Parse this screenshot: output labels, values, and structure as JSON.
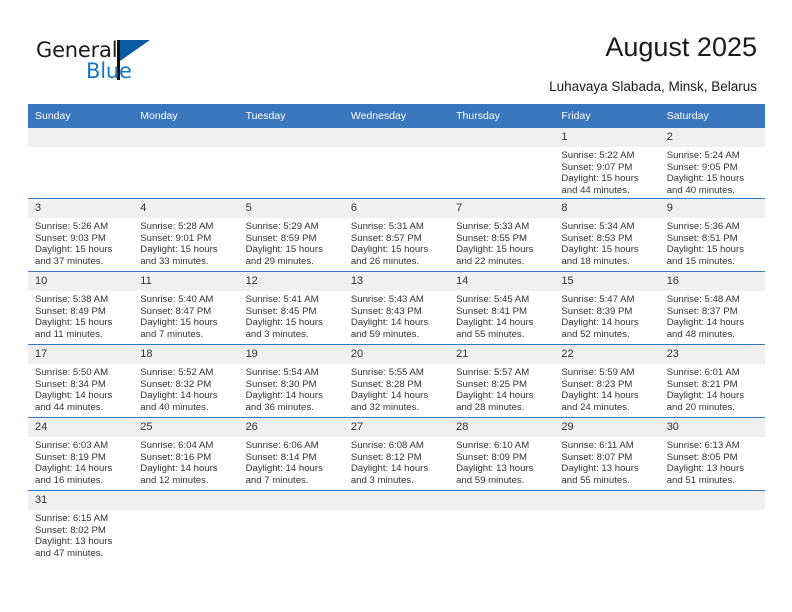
{
  "brand": {
    "name_top": "General",
    "name_bottom": "Blue",
    "flag_icon": "blue-triangle-flag-icon",
    "accent_color": "#1679c2",
    "flag_color": "#0a5ba4"
  },
  "header": {
    "title": "August 2025",
    "subtitle": "Luhavaya Slabada, Minsk, Belarus"
  },
  "calendar": {
    "header_bg": "#3b77bd",
    "daynum_bg": "#f0f0f0",
    "weekdays": [
      "Sunday",
      "Monday",
      "Tuesday",
      "Wednesday",
      "Thursday",
      "Friday",
      "Saturday"
    ],
    "weeks": [
      [
        {
          "day": "",
          "lines": []
        },
        {
          "day": "",
          "lines": []
        },
        {
          "day": "",
          "lines": []
        },
        {
          "day": "",
          "lines": []
        },
        {
          "day": "",
          "lines": []
        },
        {
          "day": "1",
          "lines": [
            "Sunrise: 5:22 AM",
            "Sunset: 9:07 PM",
            "Daylight: 15 hours",
            "and 44 minutes."
          ]
        },
        {
          "day": "2",
          "lines": [
            "Sunrise: 5:24 AM",
            "Sunset: 9:05 PM",
            "Daylight: 15 hours",
            "and 40 minutes."
          ]
        }
      ],
      [
        {
          "day": "3",
          "lines": [
            "Sunrise: 5:26 AM",
            "Sunset: 9:03 PM",
            "Daylight: 15 hours",
            "and 37 minutes."
          ]
        },
        {
          "day": "4",
          "lines": [
            "Sunrise: 5:28 AM",
            "Sunset: 9:01 PM",
            "Daylight: 15 hours",
            "and 33 minutes."
          ]
        },
        {
          "day": "5",
          "lines": [
            "Sunrise: 5:29 AM",
            "Sunset: 8:59 PM",
            "Daylight: 15 hours",
            "and 29 minutes."
          ]
        },
        {
          "day": "6",
          "lines": [
            "Sunrise: 5:31 AM",
            "Sunset: 8:57 PM",
            "Daylight: 15 hours",
            "and 26 minutes."
          ]
        },
        {
          "day": "7",
          "lines": [
            "Sunrise: 5:33 AM",
            "Sunset: 8:55 PM",
            "Daylight: 15 hours",
            "and 22 minutes."
          ]
        },
        {
          "day": "8",
          "lines": [
            "Sunrise: 5:34 AM",
            "Sunset: 8:53 PM",
            "Daylight: 15 hours",
            "and 18 minutes."
          ]
        },
        {
          "day": "9",
          "lines": [
            "Sunrise: 5:36 AM",
            "Sunset: 8:51 PM",
            "Daylight: 15 hours",
            "and 15 minutes."
          ]
        }
      ],
      [
        {
          "day": "10",
          "lines": [
            "Sunrise: 5:38 AM",
            "Sunset: 8:49 PM",
            "Daylight: 15 hours",
            "and 11 minutes."
          ]
        },
        {
          "day": "11",
          "lines": [
            "Sunrise: 5:40 AM",
            "Sunset: 8:47 PM",
            "Daylight: 15 hours",
            "and 7 minutes."
          ]
        },
        {
          "day": "12",
          "lines": [
            "Sunrise: 5:41 AM",
            "Sunset: 8:45 PM",
            "Daylight: 15 hours",
            "and 3 minutes."
          ]
        },
        {
          "day": "13",
          "lines": [
            "Sunrise: 5:43 AM",
            "Sunset: 8:43 PM",
            "Daylight: 14 hours",
            "and 59 minutes."
          ]
        },
        {
          "day": "14",
          "lines": [
            "Sunrise: 5:45 AM",
            "Sunset: 8:41 PM",
            "Daylight: 14 hours",
            "and 55 minutes."
          ]
        },
        {
          "day": "15",
          "lines": [
            "Sunrise: 5:47 AM",
            "Sunset: 8:39 PM",
            "Daylight: 14 hours",
            "and 52 minutes."
          ]
        },
        {
          "day": "16",
          "lines": [
            "Sunrise: 5:48 AM",
            "Sunset: 8:37 PM",
            "Daylight: 14 hours",
            "and 48 minutes."
          ]
        }
      ],
      [
        {
          "day": "17",
          "lines": [
            "Sunrise: 5:50 AM",
            "Sunset: 8:34 PM",
            "Daylight: 14 hours",
            "and 44 minutes."
          ]
        },
        {
          "day": "18",
          "lines": [
            "Sunrise: 5:52 AM",
            "Sunset: 8:32 PM",
            "Daylight: 14 hours",
            "and 40 minutes."
          ]
        },
        {
          "day": "19",
          "lines": [
            "Sunrise: 5:54 AM",
            "Sunset: 8:30 PM",
            "Daylight: 14 hours",
            "and 36 minutes."
          ]
        },
        {
          "day": "20",
          "lines": [
            "Sunrise: 5:55 AM",
            "Sunset: 8:28 PM",
            "Daylight: 14 hours",
            "and 32 minutes."
          ]
        },
        {
          "day": "21",
          "lines": [
            "Sunrise: 5:57 AM",
            "Sunset: 8:25 PM",
            "Daylight: 14 hours",
            "and 28 minutes."
          ]
        },
        {
          "day": "22",
          "lines": [
            "Sunrise: 5:59 AM",
            "Sunset: 8:23 PM",
            "Daylight: 14 hours",
            "and 24 minutes."
          ]
        },
        {
          "day": "23",
          "lines": [
            "Sunrise: 6:01 AM",
            "Sunset: 8:21 PM",
            "Daylight: 14 hours",
            "and 20 minutes."
          ]
        }
      ],
      [
        {
          "day": "24",
          "lines": [
            "Sunrise: 6:03 AM",
            "Sunset: 8:19 PM",
            "Daylight: 14 hours",
            "and 16 minutes."
          ]
        },
        {
          "day": "25",
          "lines": [
            "Sunrise: 6:04 AM",
            "Sunset: 8:16 PM",
            "Daylight: 14 hours",
            "and 12 minutes."
          ]
        },
        {
          "day": "26",
          "lines": [
            "Sunrise: 6:06 AM",
            "Sunset: 8:14 PM",
            "Daylight: 14 hours",
            "and 7 minutes."
          ]
        },
        {
          "day": "27",
          "lines": [
            "Sunrise: 6:08 AM",
            "Sunset: 8:12 PM",
            "Daylight: 14 hours",
            "and 3 minutes."
          ]
        },
        {
          "day": "28",
          "lines": [
            "Sunrise: 6:10 AM",
            "Sunset: 8:09 PM",
            "Daylight: 13 hours",
            "and 59 minutes."
          ]
        },
        {
          "day": "29",
          "lines": [
            "Sunrise: 6:11 AM",
            "Sunset: 8:07 PM",
            "Daylight: 13 hours",
            "and 55 minutes."
          ]
        },
        {
          "day": "30",
          "lines": [
            "Sunrise: 6:13 AM",
            "Sunset: 8:05 PM",
            "Daylight: 13 hours",
            "and 51 minutes."
          ]
        }
      ],
      [
        {
          "day": "31",
          "lines": [
            "Sunrise: 6:15 AM",
            "Sunset: 8:02 PM",
            "Daylight: 13 hours",
            "and 47 minutes."
          ]
        },
        {
          "day": "",
          "lines": []
        },
        {
          "day": "",
          "lines": []
        },
        {
          "day": "",
          "lines": []
        },
        {
          "day": "",
          "lines": []
        },
        {
          "day": "",
          "lines": []
        },
        {
          "day": "",
          "lines": []
        }
      ]
    ]
  }
}
